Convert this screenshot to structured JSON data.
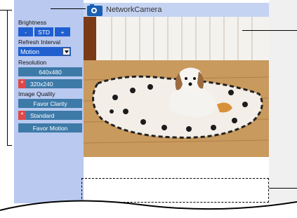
{
  "header": {
    "camera_name": "NetworkCamera"
  },
  "sidebar": {
    "brightness_label": "Brightness",
    "brightness_buttons": [
      "-",
      "STD",
      "+"
    ],
    "refresh_label": "Refresh Interval",
    "refresh_value": "Motion",
    "resolution_label": "Resolution",
    "resolution_options": [
      "640x480",
      "320x240"
    ],
    "resolution_selected": "320x240",
    "quality_label": "Image Quality",
    "quality_options": [
      "Favor Clarity",
      "Standard",
      "Favor Motion"
    ],
    "quality_selected": "Standard",
    "selected_marker": "*"
  },
  "colors": {
    "sidebar": "#b9c9f0",
    "button_blue": "#1f5fd0",
    "button_gray": "#3d7aa8",
    "selected_marker": "#e04848"
  },
  "icons": {
    "camera": "camera-icon",
    "dropdown": "chevron-down-icon"
  }
}
